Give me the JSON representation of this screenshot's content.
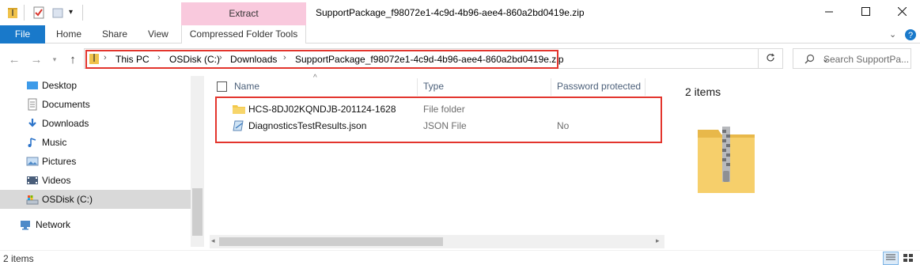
{
  "window": {
    "title": "SupportPackage_f98072e1-4c9d-4b96-aee4-860a2bd0419e.zip",
    "contextual_tab": "Extract",
    "minimize_icon": "minimize-icon",
    "maximize_icon": "maximize-icon",
    "close_icon": "close-icon"
  },
  "ribbon": {
    "file": "File",
    "home": "Home",
    "share": "Share",
    "view": "View",
    "compressed_tools": "Compressed Folder Tools",
    "file_color": "#1979ca",
    "contextual_color": "#f9c9dd"
  },
  "address": {
    "crumbs": [
      "This PC",
      "OSDisk (C:)",
      "Downloads",
      "SupportPackage_f98072e1-4c9d-4b96-aee4-860a2bd0419e.zip"
    ],
    "search_placeholder": "Search SupportPa...",
    "highlight_color": "#e3352d"
  },
  "sidebar": {
    "items": [
      {
        "label": "Desktop",
        "icon": "desktop-icon"
      },
      {
        "label": "Documents",
        "icon": "documents-icon"
      },
      {
        "label": "Downloads",
        "icon": "downloads-icon"
      },
      {
        "label": "Music",
        "icon": "music-icon"
      },
      {
        "label": "Pictures",
        "icon": "pictures-icon"
      },
      {
        "label": "Videos",
        "icon": "videos-icon"
      },
      {
        "label": "OSDisk (C:)",
        "icon": "drive-icon",
        "selected": true
      },
      {
        "label": "Network",
        "icon": "network-icon"
      }
    ]
  },
  "list": {
    "columns": {
      "name": "Name",
      "type": "Type",
      "password": "Password protected"
    },
    "rows": [
      {
        "name": "HCS-8DJ02KQNDJB-201124-1628",
        "type": "File folder",
        "password": "",
        "icon": "folder-icon"
      },
      {
        "name": "DiagnosticsTestResults.json",
        "type": "JSON File",
        "password": "No",
        "icon": "json-file-icon"
      }
    ]
  },
  "details": {
    "count": "2 items",
    "preview_icon": "zip-folder-icon"
  },
  "status": {
    "count": "2 items"
  }
}
